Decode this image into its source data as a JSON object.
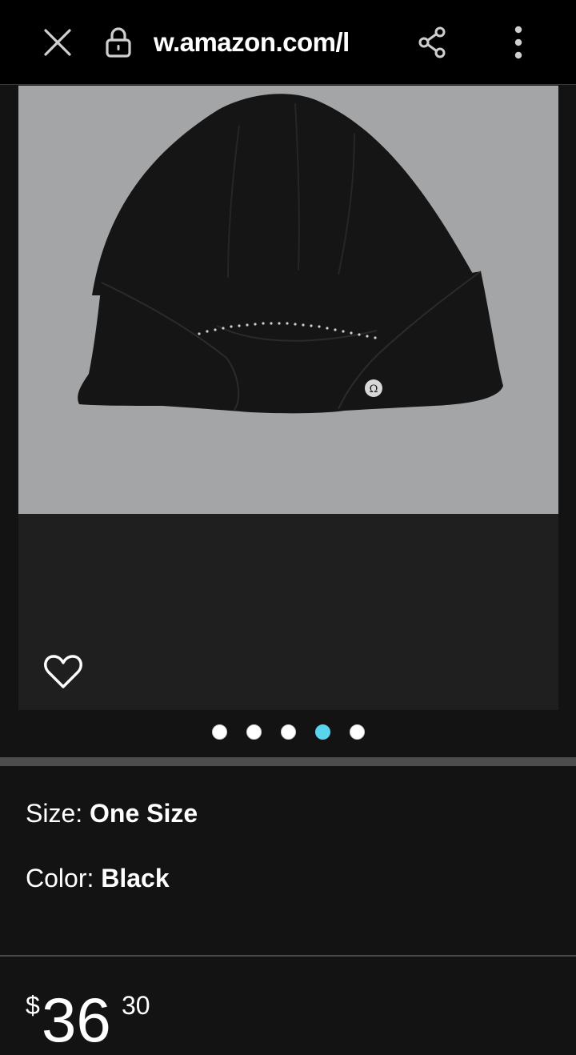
{
  "browser": {
    "url": "w.amazon.com/l",
    "icons": {
      "close": "close-icon",
      "lock": "lock-icon",
      "share": "share-icon",
      "menu": "more-vertical-icon"
    }
  },
  "product_gallery": {
    "image_alt": "black beanie hat",
    "image_count": 5,
    "active_image_index": 3,
    "colors": {
      "active_dot": "#5ad3ec",
      "inactive_dot": "#ffffff"
    }
  },
  "attributes": {
    "size_label": "Size:",
    "size_value": "One Size",
    "color_label": "Color:",
    "color_value": "Black"
  },
  "price": {
    "currency_symbol": "$",
    "whole": "36",
    "fraction": "30"
  }
}
